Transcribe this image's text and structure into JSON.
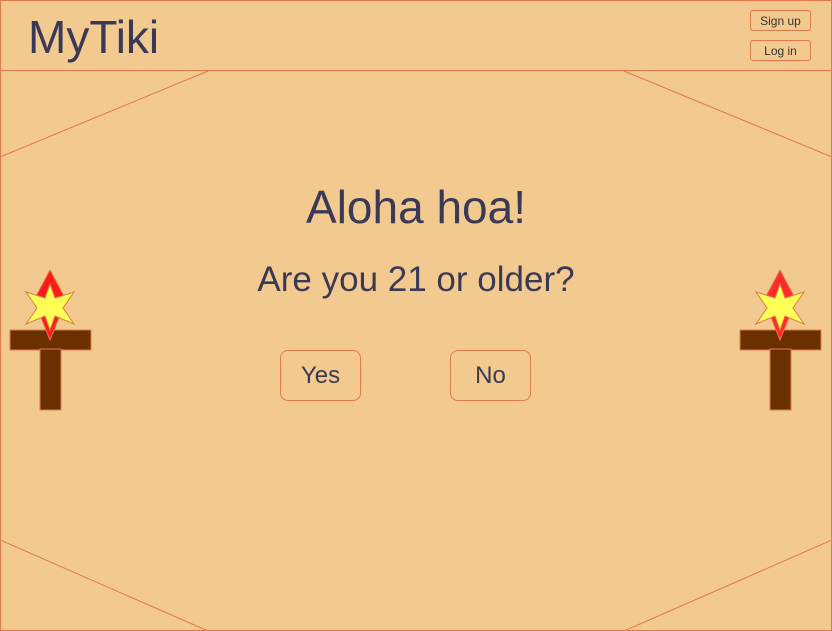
{
  "app": {
    "title": "MyTiki"
  },
  "header": {
    "signup_label": "Sign up",
    "login_label": "Log in"
  },
  "main": {
    "heading": "Aloha hoa!",
    "question": "Are you 21 or older?",
    "yes_label": "Yes",
    "no_label": "No"
  },
  "icons": {
    "left": "tiki-torch-icon",
    "right": "tiki-torch-icon"
  },
  "colors": {
    "background": "#f2c98e",
    "border": "#e07a4a",
    "text": "#3a3a56",
    "torch_post": "#6b3000",
    "flame_outer": "#ff1a1a",
    "flame_inner": "#ffff55"
  }
}
